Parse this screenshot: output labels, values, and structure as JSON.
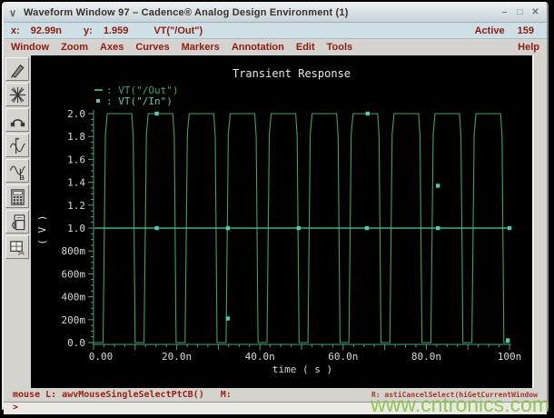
{
  "window": {
    "title": "Waveform Window 97 – Cadence® Analog Design Environment (1)",
    "chevron_glyph": "∨",
    "buttons": [
      {
        "name": "minimize-button",
        "glyph": "–"
      },
      {
        "name": "maximize-button",
        "glyph": "□"
      },
      {
        "name": "close-button",
        "glyph": "✕"
      }
    ]
  },
  "readout": {
    "x_label": "x:",
    "x_value": "92.99n",
    "y_label": "y:",
    "y_value": "1.959",
    "trace": "VT(\"/Out\")",
    "active_label": "Active",
    "active_value": "159"
  },
  "menubar": {
    "items": [
      "Window",
      "Zoom",
      "Axes",
      "Curves",
      "Markers",
      "Annotation",
      "Edit",
      "Tools"
    ],
    "help": "Help"
  },
  "toolbar": {
    "icons": [
      "pen-tool-icon",
      "star-burst-icon",
      "arc-probe-icon",
      "vert-marker-a-icon",
      "waveform-marker-b-icon",
      "calculator-icon",
      "copy-window-icon",
      "snip-window-icon"
    ]
  },
  "statusbar": {
    "left": "mouse L: awvMouseSingleSelectPtCB()",
    "middle": "M:",
    "right": "R: astiCancelSelect(hiGetCurrentWindow"
  },
  "prompt": {
    "symbol": ">"
  },
  "watermark": {
    "text": "www.cntronics.com"
  },
  "chart_data": {
    "type": "line",
    "title": "Transient Response",
    "xlabel": "time ( s )",
    "ylabel": "( V )",
    "xlim_ns": [
      0,
      100
    ],
    "ylim_v": [
      0,
      2.0
    ],
    "x_ticks": [
      {
        "t": 0,
        "label": "0.00"
      },
      {
        "t": 20,
        "label": "20.0n"
      },
      {
        "t": 40,
        "label": "40.0n"
      },
      {
        "t": 60,
        "label": "60.0n"
      },
      {
        "t": 80,
        "label": "80.0n"
      },
      {
        "t": 100,
        "label": "100n"
      }
    ],
    "x_minor_step_ns": 2.5,
    "x_major_step_ns": 10,
    "y_ticks": [
      {
        "v": 0.0,
        "label": "0.0"
      },
      {
        "v": 0.2,
        "label": "200m"
      },
      {
        "v": 0.4,
        "label": "400m"
      },
      {
        "v": 0.6,
        "label": "600m"
      },
      {
        "v": 0.8,
        "label": "800m"
      },
      {
        "v": 1.0,
        "label": "1.0"
      },
      {
        "v": 1.2,
        "label": "1.2"
      },
      {
        "v": 1.4,
        "label": "1.4"
      },
      {
        "v": 1.6,
        "label": "1.6"
      },
      {
        "v": 1.8,
        "label": "1.8"
      },
      {
        "v": 2.0,
        "label": "2.0"
      }
    ],
    "y_minor_step_v": 0.05,
    "axis_color": "#46a47c",
    "text_color": "#d9d9d9",
    "legend": [
      {
        "symbol": "dash",
        "name": "VT(\"/Out\")"
      },
      {
        "symbol": "dot",
        "name": "VT(\"/In\")"
      }
    ],
    "series": [
      {
        "name": "VT(\"/Out\")",
        "color": "#3fa263",
        "style": "line",
        "shape": "square-wave",
        "low_v": 0.0,
        "high_v": 2.0,
        "period_ns": 9.85,
        "first_rise_ns": 2.3,
        "rise_ns": 1.0,
        "high_dur_ns": 6.9,
        "fall_ns": 0.8,
        "cycles": 10
      },
      {
        "name": "VT(\"/In\")",
        "color": "#55c8ad",
        "style": "line-with-points",
        "value_v": 1.0,
        "t_start_ns": 0.2,
        "t_end_ns": 100,
        "marker_ts_ns": [
          15.2,
          32.3,
          49.3,
          65.7,
          82.8,
          100
        ],
        "extra_points": [
          [
            15.2,
            2.0
          ],
          [
            32.3,
            0.21
          ],
          [
            65.9,
            2.0
          ],
          [
            82.8,
            1.37
          ],
          [
            99.6,
            0.02
          ]
        ]
      }
    ]
  }
}
